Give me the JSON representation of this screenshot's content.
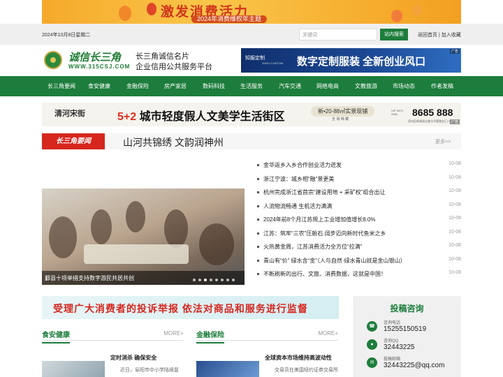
{
  "top_banner": {
    "title": "激发消费活力",
    "subtitle": "2024年消费维权年主题"
  },
  "topbar": {
    "date": "2024年10月8日星期二",
    "search_placeholder": "关键词",
    "search_button": "站内搜索",
    "links": "返回首页 | 加入收藏"
  },
  "logo": {
    "name": "诚信长三角",
    "url": "WWW.315CSJ.COM",
    "tagline1": "长三角诚信名片",
    "tagline2": "企业信用公共服务平台"
  },
  "ad_right": {
    "brand": "知服定制",
    "brand_sub": "ZHIFU CUSTOM",
    "text": "数字定制服装  全新创业风口",
    "tag": "广告"
  },
  "nav": [
    "长三角要闻",
    "食安健康",
    "金融保险",
    "房产家居",
    "数码科技",
    "生活服务",
    "汽车交通",
    "网络电商",
    "文教旅游",
    "市场动态",
    "作者发稿"
  ],
  "ad_mid": {
    "logo": "清河宋街",
    "slogan_num": "5+2",
    "slogan": "城市轻度假人文美学生活街区",
    "area": "新•20-88㎡实景现铺",
    "area2": "全 城 稀 藏",
    "phone_label": "VIP INFO 0556",
    "phone": "8685 888",
    "address": "滨州区新城丽水路与华蓉路交汇口",
    "tag": "广告"
  },
  "section": {
    "label": "长三角要闻",
    "headline": "山河共锦绣 文韵润神州",
    "more": "更多>>"
  },
  "news": [
    {
      "title": "金华返乡入乡合作创业活力迸发",
      "date": "10-08"
    },
    {
      "title": "浙江宁波：城乡相“融”景更美",
      "date": "10-08"
    },
    {
      "title": "杭州完成浙江省首宗“建设用地 + 采矿权”组合出让",
      "date": "10-08"
    },
    {
      "title": "人流物流畅通 生机活力满满",
      "date": "10-08"
    },
    {
      "title": "2024年前8个月江苏规上工业增加值增长8.0%",
      "date": "10-08"
    },
    {
      "title": "江苏：筑牢“三农”压舱石 阔步迈向新时代鱼米之乡",
      "date": "10-08"
    },
    {
      "title": "火热黄金周，江苏消费活力全方位“拉满”",
      "date": "10-08"
    },
    {
      "title": "青山有“价” 绿水含“金”（人与自然·绿水青山就是金山银山）",
      "date": "10-08"
    },
    {
      "title": "不断刷新的出行、文旅、消费数据，这就是中国！",
      "date": "10-08"
    }
  ],
  "slide": {
    "caption": "鄞县十项举措支持数字游民共居共创"
  },
  "ad_low": {
    "text": "受理广大消费者的投诉举报  依法对商品和服务进行监督"
  },
  "col1": {
    "heading": "食安健康",
    "more": "MORE+",
    "article_title": "定时消杀 确保安全",
    "article_desc": "近日，阜阳市中小学陆续复"
  },
  "col2": {
    "heading": "金融保险",
    "more": "MORE+",
    "article_title": "全球资本市场维持高波动性",
    "article_desc": "交易员在美国纽约证券交易所"
  },
  "contact": {
    "title": "投稿咨询",
    "rows": [
      {
        "label": "咨询电话",
        "value": "15255150519"
      },
      {
        "label": "咨询QQ",
        "value": "32443225"
      },
      {
        "label": "投稿邮箱",
        "value": "32443225@qq.com"
      }
    ]
  },
  "colors": {
    "brand_green": "#1d7d3c",
    "accent_red": "#d7261e"
  }
}
